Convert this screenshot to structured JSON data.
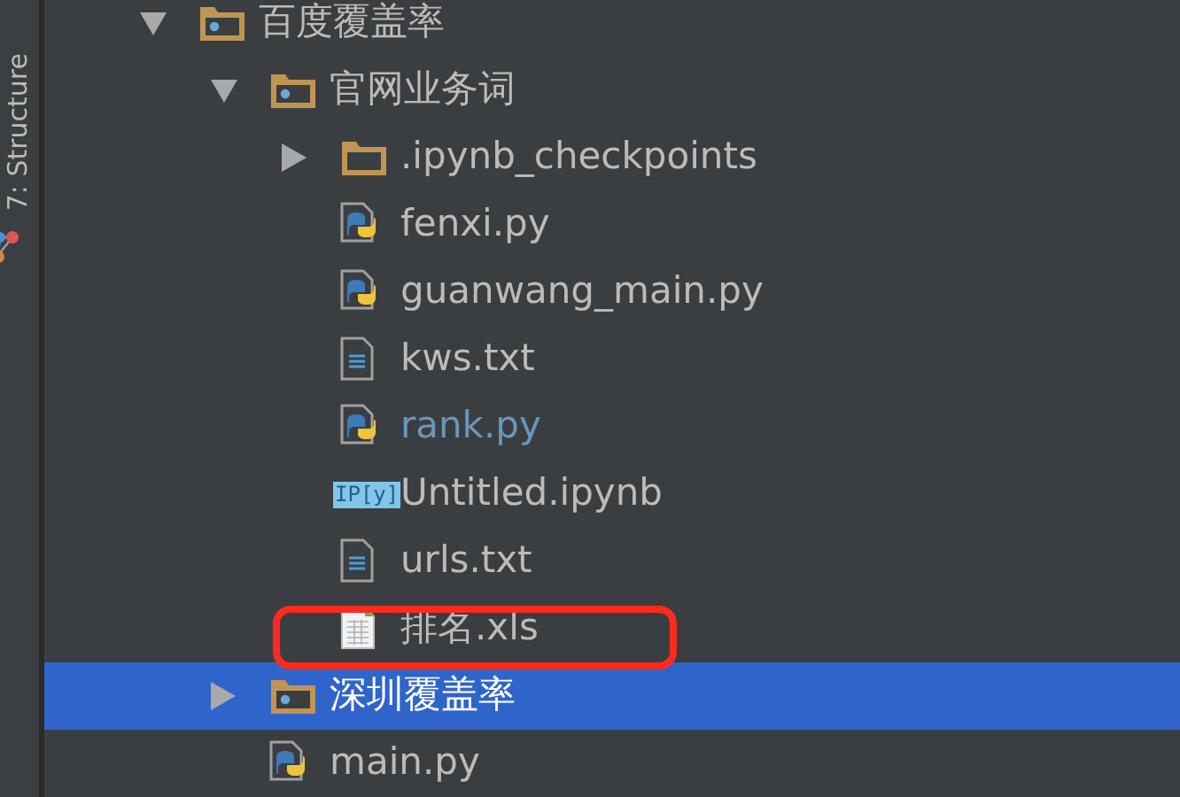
{
  "side_panel": {
    "tab_label": "7: Structure"
  },
  "tree": [
    {
      "label": "百度覆盖率",
      "kind": "package",
      "expanded": true,
      "selected": false,
      "color": "#bbbbbb",
      "children": [
        {
          "label": "官网业务词",
          "kind": "package",
          "expanded": true,
          "selected": false,
          "color": "#bbbbbb",
          "children": [
            {
              "label": ".ipynb_checkpoints",
              "kind": "folder",
              "expanded": false,
              "selected": false,
              "color": "#bbbbbb"
            },
            {
              "label": "fenxi.py",
              "kind": "python",
              "selected": false,
              "color": "#bbbbbb"
            },
            {
              "label": "guanwang_main.py",
              "kind": "python",
              "selected": false,
              "color": "#bbbbbb"
            },
            {
              "label": "kws.txt",
              "kind": "text",
              "selected": false,
              "color": "#bbbbbb"
            },
            {
              "label": "rank.py",
              "kind": "python",
              "selected": false,
              "color": "#6897bb"
            },
            {
              "label": "Untitled.ipynb",
              "kind": "notebook",
              "icon_text": "IP[y]",
              "selected": false,
              "color": "#bbbbbb"
            },
            {
              "label": "urls.txt",
              "kind": "text",
              "selected": false,
              "color": "#bbbbbb"
            },
            {
              "label": "排名.xls",
              "kind": "spreadsheet",
              "selected": false,
              "color": "#bbbbbb"
            }
          ]
        },
        {
          "label": "深圳覆盖率",
          "kind": "package",
          "expanded": false,
          "selected": true,
          "color": "#ffffff"
        },
        {
          "label": "main.py",
          "kind": "python",
          "selected": false,
          "color": "#bbbbbb"
        }
      ]
    }
  ],
  "annotation": {
    "kind": "rounded",
    "color": "#ff2a1f"
  }
}
